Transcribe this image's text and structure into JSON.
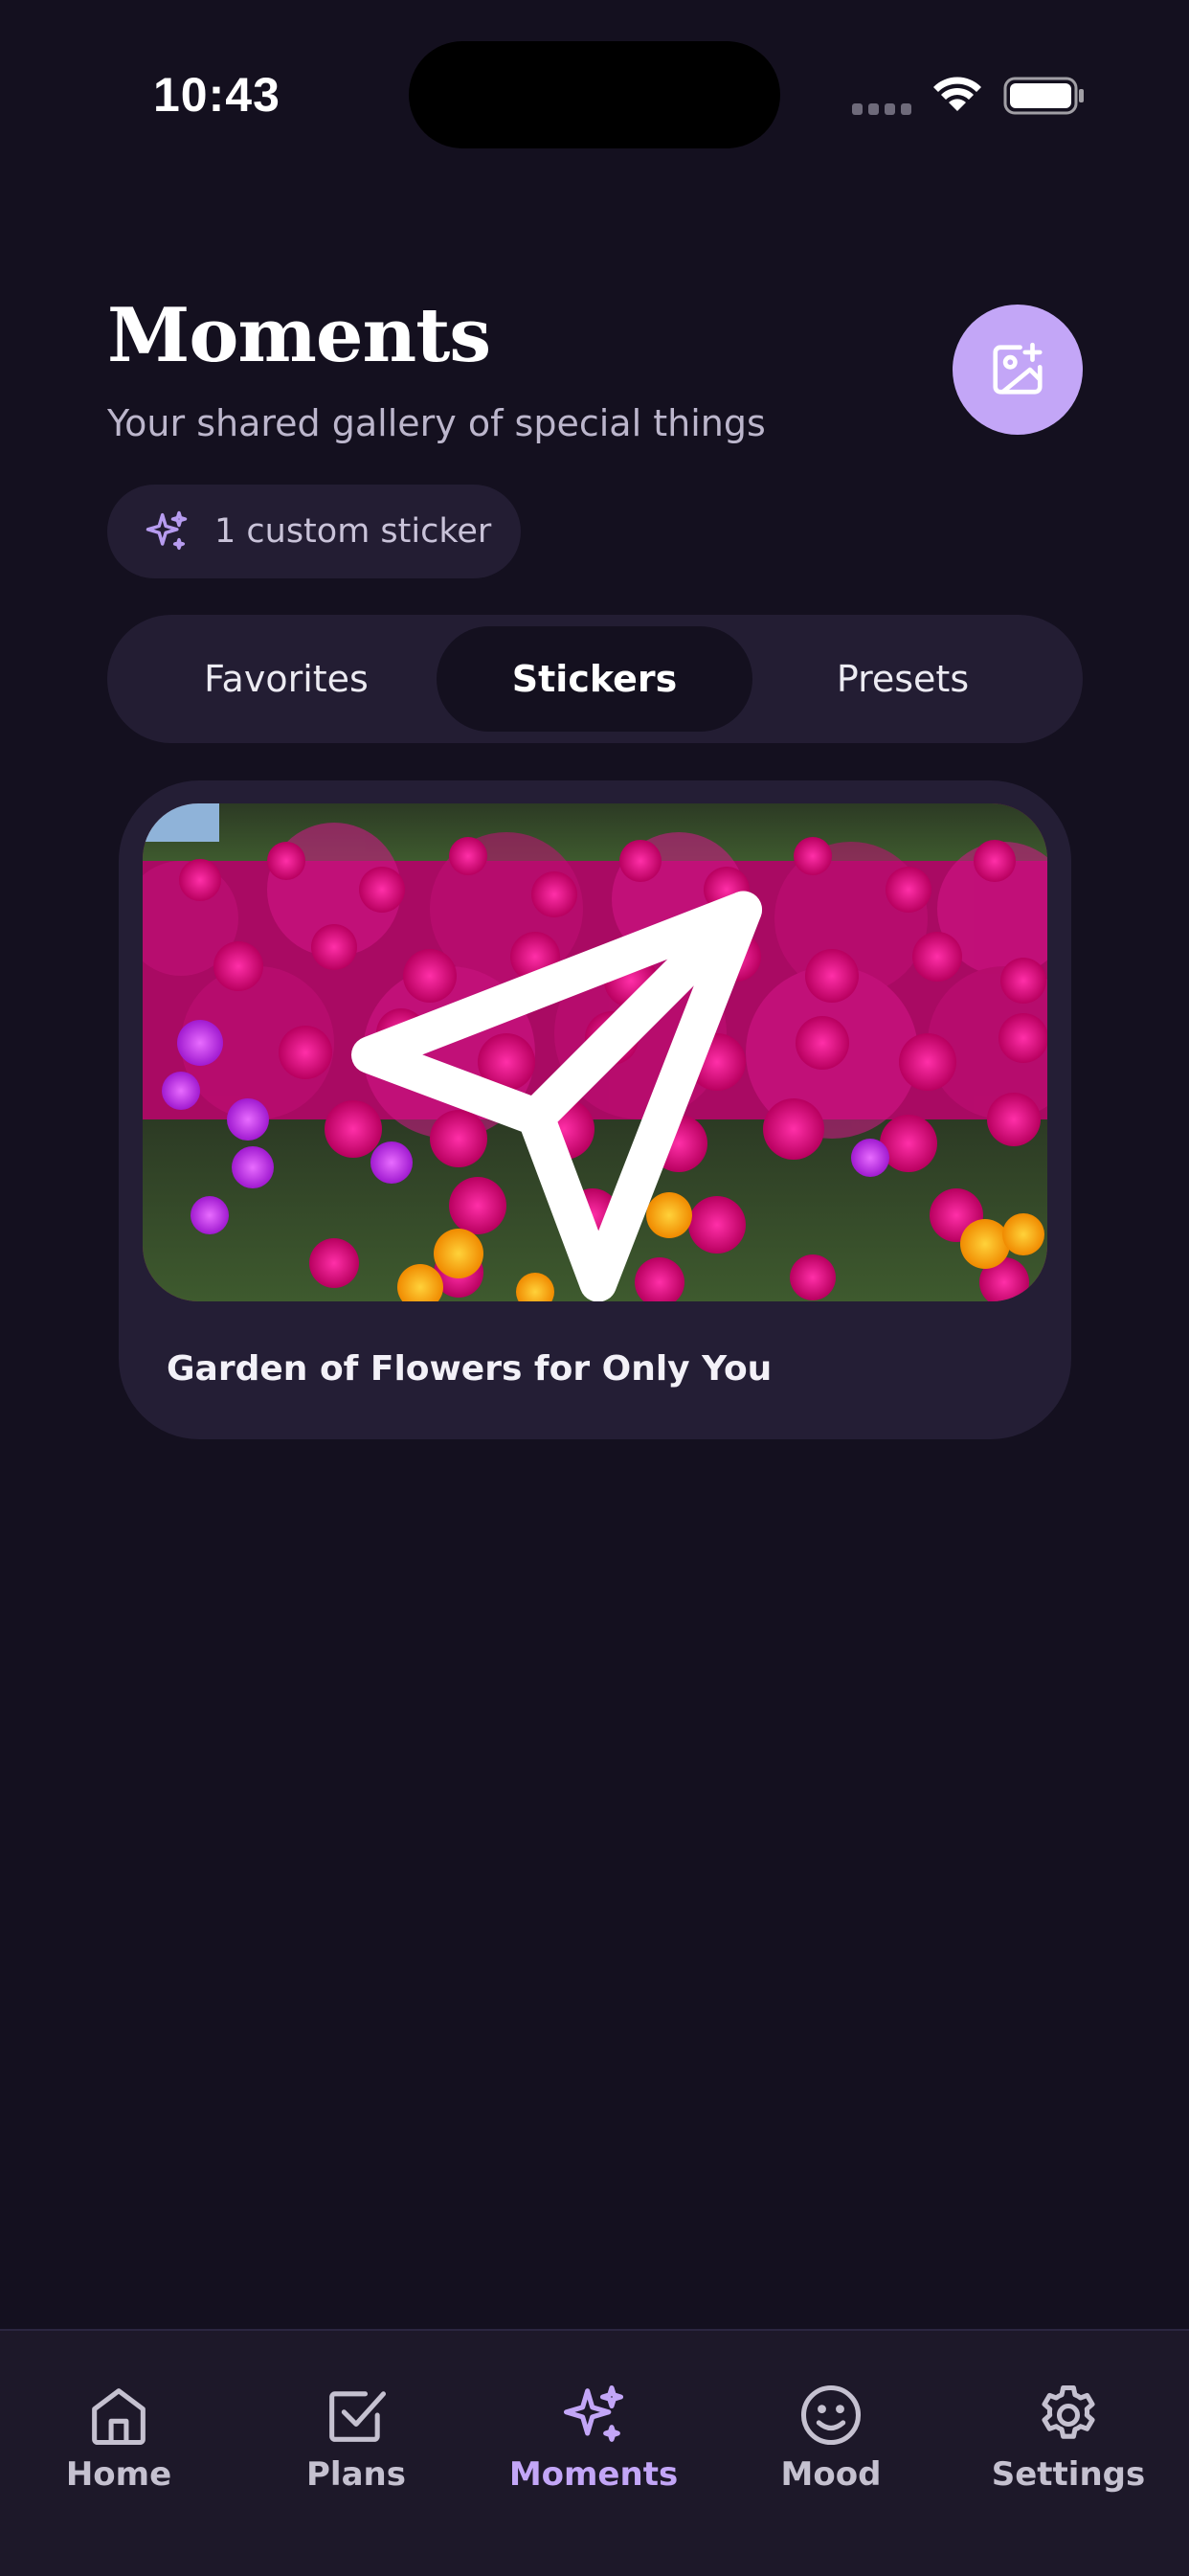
{
  "status_bar": {
    "time": "10:43"
  },
  "header": {
    "title": "Moments",
    "subtitle": "Your shared gallery of special things",
    "add_button_icon": "add-photo-icon"
  },
  "sticker_chip": {
    "icon": "sparkle-icon",
    "label": "1 custom sticker"
  },
  "segments": [
    {
      "label": "Favorites",
      "active": false
    },
    {
      "label": "Stickers",
      "active": true
    },
    {
      "label": "Presets",
      "active": false
    }
  ],
  "cards": [
    {
      "caption": "Garden of Flowers for Only You",
      "image": "flower-garden-photo",
      "action_icon": "send-icon"
    }
  ],
  "tab_bar": {
    "items": [
      {
        "label": "Home",
        "icon": "home-icon",
        "active": false
      },
      {
        "label": "Plans",
        "icon": "checkbox-icon",
        "active": false
      },
      {
        "label": "Moments",
        "icon": "sparkle-icon",
        "active": true
      },
      {
        "label": "Mood",
        "icon": "smiley-icon",
        "active": false
      },
      {
        "label": "Settings",
        "icon": "gear-icon",
        "active": false
      }
    ]
  },
  "colors": {
    "background": "#14101f",
    "surface": "#231d33",
    "accent": "#c3a6f7",
    "tab_bar": "#1d1829"
  }
}
